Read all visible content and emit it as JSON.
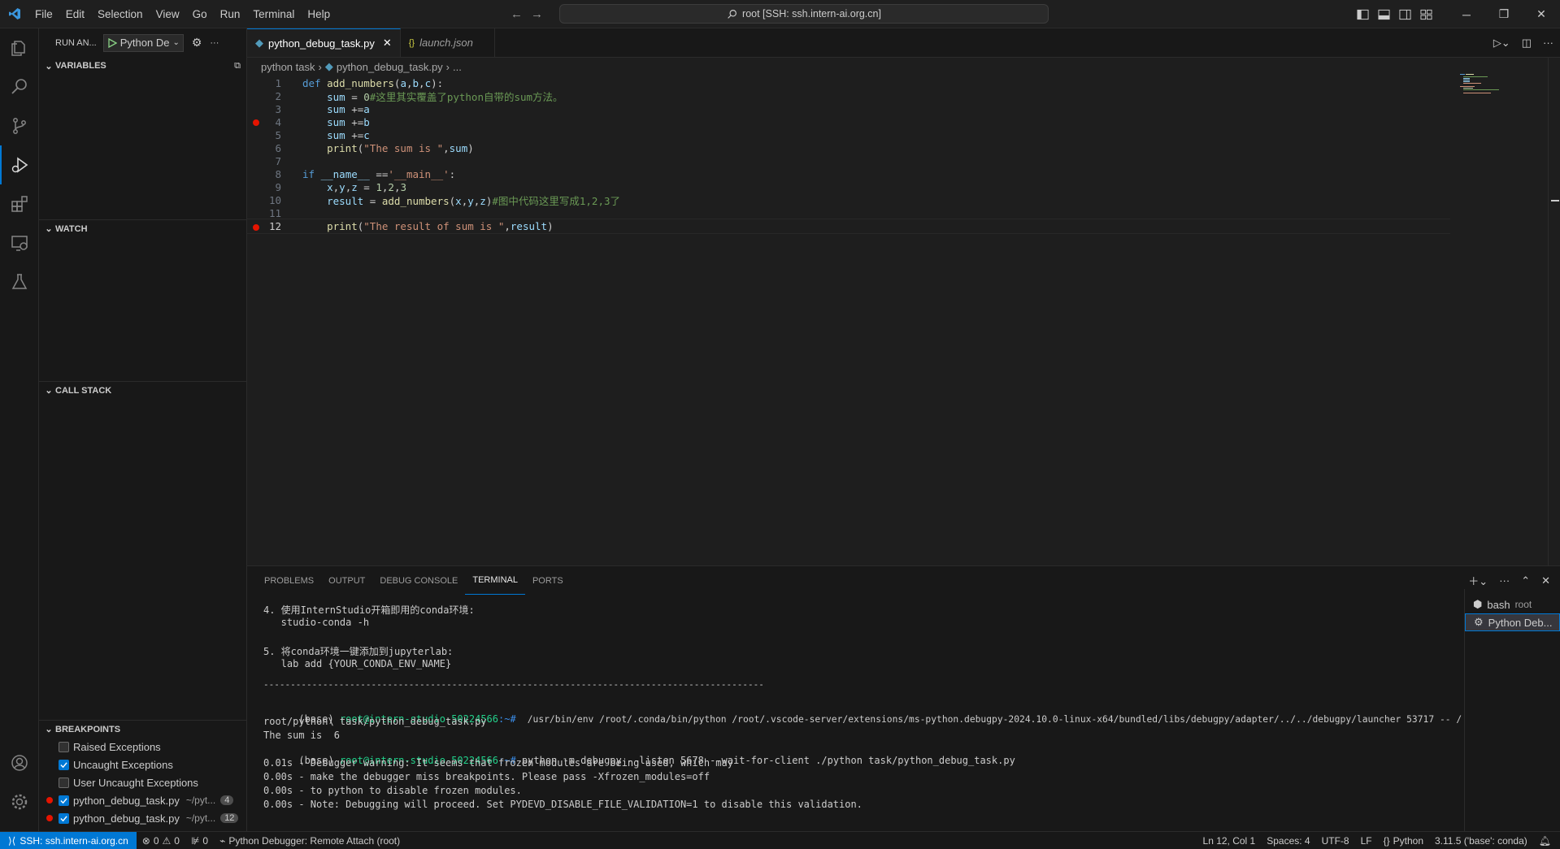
{
  "titlebar": {
    "menu": [
      "File",
      "Edit",
      "Selection",
      "View",
      "Go",
      "Run",
      "Terminal",
      "Help"
    ],
    "command_center": "root [SSH: ssh.intern-ai.org.cn]"
  },
  "sidebar": {
    "header": "RUN AN...",
    "run_config": "Python De",
    "sections": {
      "variables": "VARIABLES",
      "watch": "WATCH",
      "call_stack": "CALL STACK",
      "breakpoints": "BREAKPOINTS"
    },
    "exception_breakpoints": [
      {
        "label": "Raised Exceptions",
        "checked": false
      },
      {
        "label": "Uncaught Exceptions",
        "checked": true
      },
      {
        "label": "User Uncaught Exceptions",
        "checked": false
      }
    ],
    "file_breakpoints": [
      {
        "file": "python_debug_task.py",
        "path": "~/pyt...",
        "line": "4"
      },
      {
        "file": "python_debug_task.py",
        "path": "~/pyt...",
        "line": "12"
      }
    ]
  },
  "editor": {
    "tabs": [
      {
        "label": "python_debug_task.py",
        "active": true
      },
      {
        "label": "launch.json",
        "active": false
      }
    ],
    "breadcrumb": [
      "python task",
      "python_debug_task.py",
      "..."
    ],
    "current_line": 12,
    "breakpoint_lines": [
      4,
      12
    ]
  },
  "panel": {
    "tabs": [
      "PROBLEMS",
      "OUTPUT",
      "DEBUG CONSOLE",
      "TERMINAL",
      "PORTS"
    ],
    "active_tab": "TERMINAL",
    "terminal_lines": {
      "l1": "4. 使用InternStudio开箱即用的conda环境:",
      "l2": "   studio-conda -h",
      "l3": "5. 将conda环境一键添加到jupyterlab:",
      "l4": "   lab add {YOUR_CONDA_ENV_NAME}",
      "l5": "---------------------------------------------------------------------------------------------",
      "p1_base": "(base) ",
      "p1_user": "root@intern-studio-50224566",
      "p1_path": ":~# ",
      "p1_cmd": " /usr/bin/env /root/.conda/bin/python /root/.vscode-server/extensions/ms-python.debugpy-2024.10.0-linux-x64/bundled/libs/debugpy/adapter/../../debugpy/launcher 53717 -- /",
      "l6": "root/python\\ task/python_debug_task.py",
      "l7": "The sum is  6",
      "p2_base": "(base) ",
      "p2_user": "root@intern-studio-50224566",
      "p2_path": ":~# ",
      "p2_cmd": "python -m debugpy --listen 5678 --wait-for-client ./python task/python_debug_task.py",
      "l8": "0.01s - Debugger warning: It seems that frozen modules are being used, which may",
      "l9": "0.00s - make the debugger miss breakpoints. Please pass -Xfrozen_modules=off",
      "l10": "0.00s - to python to disable frozen modules.",
      "l11": "0.00s - Note: Debugging will proceed. Set PYDEVD_DISABLE_FILE_VALIDATION=1 to disable this validation."
    },
    "terminals": [
      {
        "name": "bash",
        "sub": "root"
      },
      {
        "name": "Python Deb..."
      }
    ]
  },
  "statusbar": {
    "remote": "SSH: ssh.intern-ai.org.cn",
    "errors": "0",
    "warnings": "0",
    "ports": "0",
    "debug": "Python Debugger: Remote Attach (root)",
    "position": "Ln 12, Col 1",
    "spaces": "Spaces: 4",
    "encoding": "UTF-8",
    "eol": "LF",
    "language": "Python",
    "interpreter": "3.11.5 ('base': conda)"
  },
  "colors": {
    "accent": "#0078d4",
    "breakpoint": "#e51400",
    "terminal_user": "#23d18b",
    "terminal_path": "#3b8eea"
  }
}
